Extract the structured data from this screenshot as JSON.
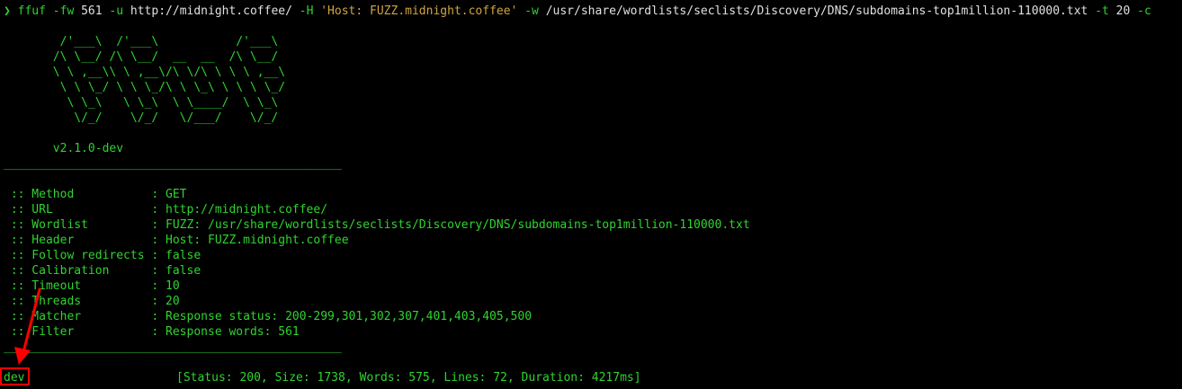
{
  "command": {
    "prompt": "❯",
    "program": "ffuf",
    "flag_fw": "-fw",
    "fw_value": "561",
    "flag_u": "-u",
    "url": "http://midnight.coffee/",
    "flag_h": "-H",
    "header": "'Host: FUZZ.midnight.coffee'",
    "flag_w": "-w",
    "wordlist": "/usr/share/wordlists/seclists/Discovery/DNS/subdomains-top1million-110000.txt",
    "flag_t": "-t",
    "threads": "20",
    "flag_c": "-c"
  },
  "banner": {
    "lines": [
      "        /'___\\  /'___\\           /'___\\",
      "       /\\ \\__/ /\\ \\__/  __  __  /\\ \\__/",
      "       \\ \\ ,__\\\\ \\ ,__\\/\\ \\/\\ \\ \\ \\ ,__\\",
      "        \\ \\ \\_/ \\ \\ \\_/\\ \\ \\_\\ \\ \\ \\ \\_/",
      "         \\ \\_\\   \\ \\_\\  \\ \\____/  \\ \\_\\",
      "          \\/_/    \\/_/   \\/___/    \\/_/"
    ],
    "version": "       v2.1.0-dev"
  },
  "separator": "________________________________________________",
  "config": [
    {
      "key": " :: Method           ",
      "value": ": GET"
    },
    {
      "key": " :: URL              ",
      "value": ": http://midnight.coffee/"
    },
    {
      "key": " :: Wordlist         ",
      "value": ": FUZZ: /usr/share/wordlists/seclists/Discovery/DNS/subdomains-top1million-110000.txt"
    },
    {
      "key": " :: Header           ",
      "value": ": Host: FUZZ.midnight.coffee"
    },
    {
      "key": " :: Follow redirects ",
      "value": ": false"
    },
    {
      "key": " :: Calibration      ",
      "value": ": false"
    },
    {
      "key": " :: Timeout          ",
      "value": ": 10"
    },
    {
      "key": " :: Threads          ",
      "value": ": 20"
    },
    {
      "key": " :: Matcher          ",
      "value": ": Response status: 200-299,301,302,307,401,403,405,500"
    },
    {
      "key": " :: Filter           ",
      "value": ": Response words: 561"
    }
  ],
  "result": {
    "word": "dev",
    "info": "[Status: 200, Size: 1738, Words: 575, Lines: 72, Duration: 4217ms]"
  },
  "colors": {
    "terminal_bg": "#000000",
    "text_green": "#2fd42f",
    "string_orange": "#d0a540",
    "annotation_red": "#ff0000"
  }
}
